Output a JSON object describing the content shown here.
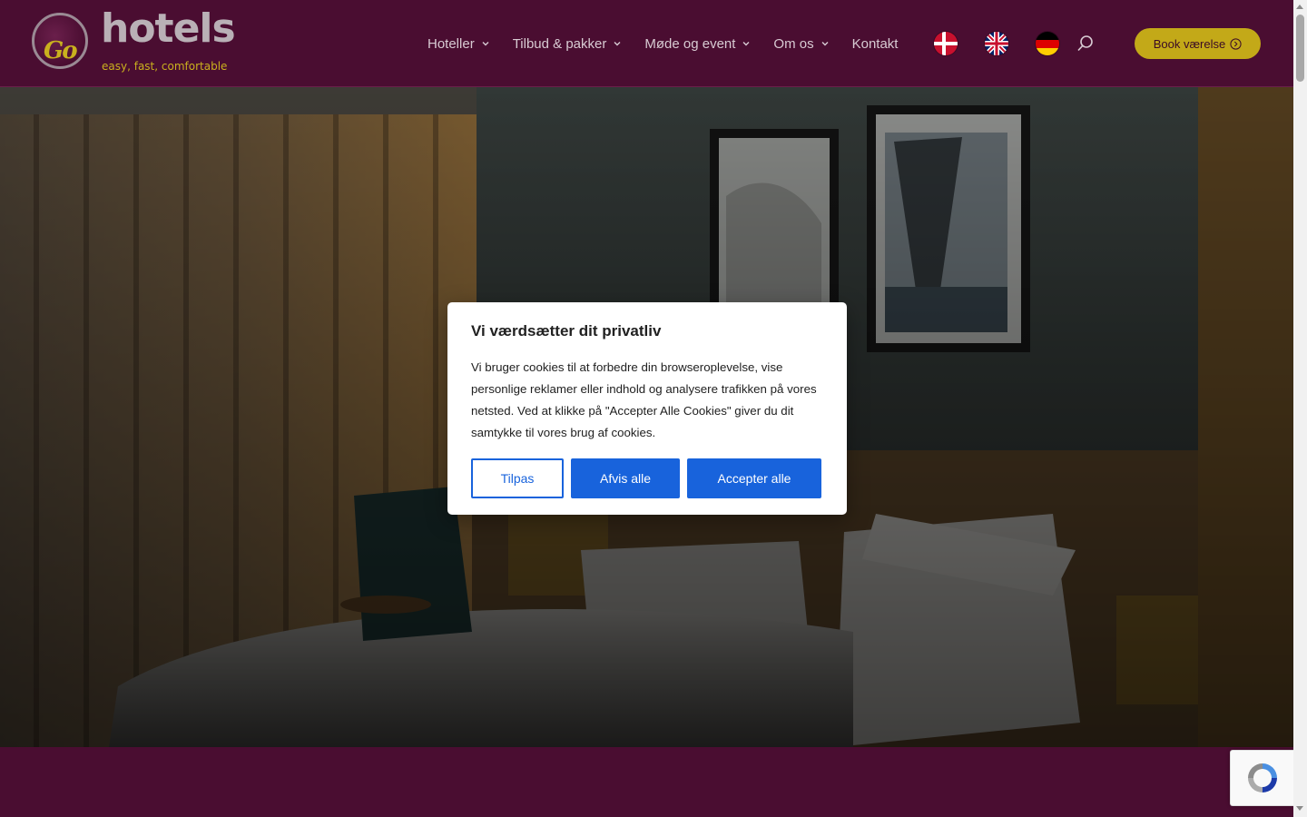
{
  "brand": {
    "logo_mark": "Go",
    "logo_word": "hotels",
    "tagline": "easy, fast, comfortable"
  },
  "nav": {
    "items": [
      {
        "label": "Hoteller",
        "has_dropdown": true
      },
      {
        "label": "Tilbud & pakker",
        "has_dropdown": true
      },
      {
        "label": "Møde og event",
        "has_dropdown": true
      },
      {
        "label": "Om os",
        "has_dropdown": true
      },
      {
        "label": "Kontakt",
        "has_dropdown": false
      }
    ],
    "languages": [
      "danish-flag-icon",
      "uk-flag-icon",
      "german-flag-icon"
    ],
    "search_icon": "search-icon",
    "book_button": "Book værelse"
  },
  "hero": {
    "image": "hotel-room-photo"
  },
  "cookie_banner": {
    "title": "Vi værdsætter dit privatliv",
    "text": "Vi bruger cookies til at forbedre din browseroplevelse, vise personlige reklamer eller indhold og analysere trafikken på vores netsted. Ved at klikke på \"Accepter Alle Cookies\" giver du dit samtykke til vores brug af cookies.",
    "customize_label": "Tilpas",
    "reject_label": "Afvis alle",
    "accept_label": "Accepter alle"
  },
  "colors": {
    "header_bg": "#4a0d31",
    "accent_gold": "#c3a918",
    "button_blue": "#1863dc"
  }
}
